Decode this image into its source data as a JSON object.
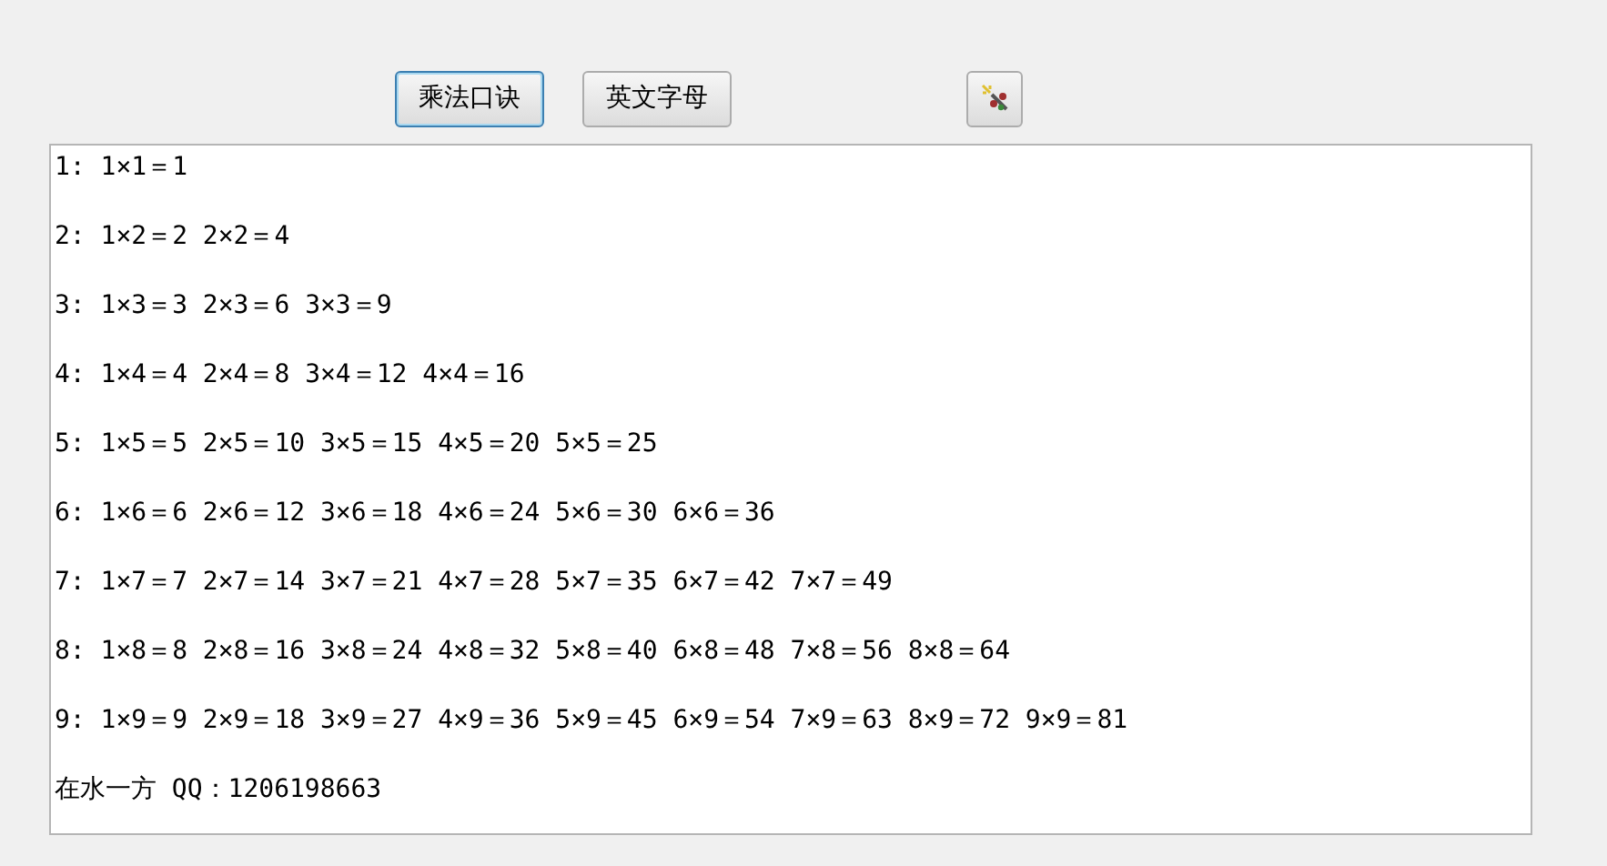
{
  "toolbar": {
    "buttons": [
      {
        "label": "乘法口诀",
        "focused": true
      },
      {
        "label": "英文字母",
        "focused": false
      }
    ],
    "icon_button": {
      "kind": "wand"
    }
  },
  "output": {
    "lines": [
      "1: 1×1＝1",
      "2: 1×2＝2 2×2＝4",
      "3: 1×3＝3 2×3＝6 3×3＝9",
      "4: 1×4＝4 2×4＝8 3×4＝12 4×4＝16",
      "5: 1×5＝5 2×5＝10 3×5＝15 4×5＝20 5×5＝25",
      "6: 1×6＝6 2×6＝12 3×6＝18 4×6＝24 5×6＝30 6×6＝36",
      "7: 1×7＝7 2×7＝14 3×7＝21 4×7＝28 5×7＝35 6×7＝42 7×7＝49",
      "8: 1×8＝8 2×8＝16 3×8＝24 4×8＝32 5×8＝40 6×8＝48 7×8＝56 8×8＝64",
      "9: 1×9＝9 2×9＝18 3×9＝27 4×9＝36 5×9＝45 6×9＝54 7×9＝63 8×9＝72 9×9＝81",
      "在水一方 QQ：1206198663"
    ]
  }
}
